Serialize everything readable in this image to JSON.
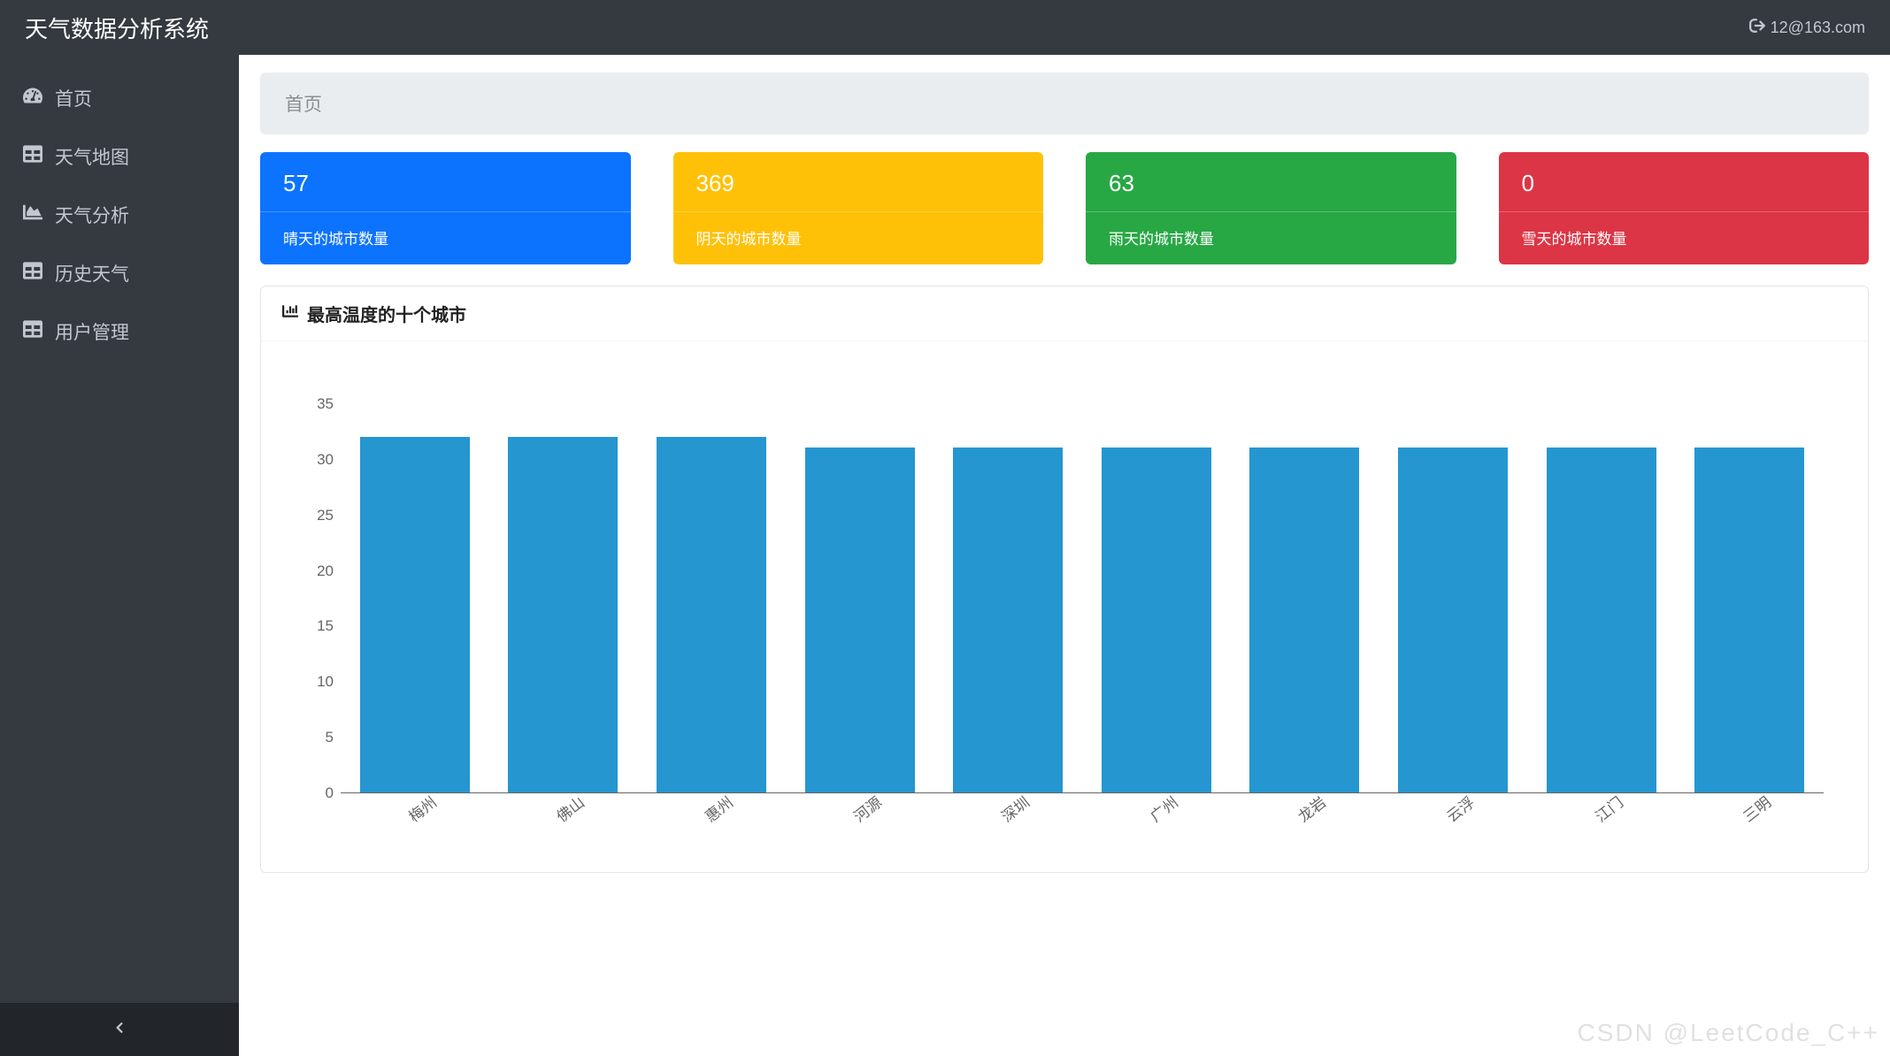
{
  "header": {
    "title": "天气数据分析系统",
    "user_label": "12@163.com"
  },
  "sidebar": {
    "items": [
      {
        "icon": "dashboard-icon",
        "label": "首页"
      },
      {
        "icon": "table-icon",
        "label": "天气地图"
      },
      {
        "icon": "chart-icon",
        "label": "天气分析"
      },
      {
        "icon": "table-icon",
        "label": "历史天气"
      },
      {
        "icon": "table-icon",
        "label": "用户管理"
      }
    ]
  },
  "breadcrumb": "首页",
  "cards": [
    {
      "value": "57",
      "label": "晴天的城市数量",
      "color": "blue"
    },
    {
      "value": "369",
      "label": "阴天的城市数量",
      "color": "yellow"
    },
    {
      "value": "63",
      "label": "雨天的城市数量",
      "color": "green"
    },
    {
      "value": "0",
      "label": "雪天的城市数量",
      "color": "red"
    }
  ],
  "panel": {
    "title": "最高温度的十个城市"
  },
  "chart_data": {
    "type": "bar",
    "categories": [
      "梅州",
      "佛山",
      "惠州",
      "河源",
      "深圳",
      "广州",
      "龙岩",
      "云浮",
      "江门",
      "三明"
    ],
    "values": [
      32,
      32,
      32,
      31,
      31,
      31,
      31,
      31,
      31,
      31
    ],
    "title": "最高温度的十个城市",
    "xlabel": "",
    "ylabel": "",
    "ylim": [
      0,
      35
    ],
    "yticks": [
      0,
      5,
      10,
      15,
      20,
      25,
      30,
      35
    ]
  },
  "watermark": "CSDN @LeetCode_C++"
}
